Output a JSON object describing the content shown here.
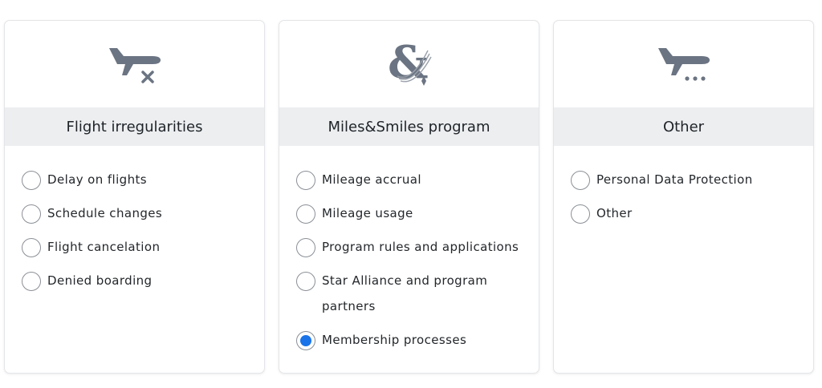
{
  "colors": {
    "icon": "#6b7482",
    "header_bg": "#eceef0",
    "radio_selected": "#1a73e8"
  },
  "cards": [
    {
      "icon": "plane-cancel-icon",
      "title": "Flight irregularities",
      "options": [
        {
          "label": "Delay on flights",
          "selected": false
        },
        {
          "label": "Schedule changes",
          "selected": false
        },
        {
          "label": "Flight cancelation",
          "selected": false
        },
        {
          "label": "Denied boarding",
          "selected": false
        }
      ]
    },
    {
      "icon": "ampersand-star-icon",
      "title": "Miles&Smiles program",
      "options": [
        {
          "label": "Mileage accrual",
          "selected": false
        },
        {
          "label": "Mileage usage",
          "selected": false
        },
        {
          "label": "Program rules and applications",
          "selected": false
        },
        {
          "label": "Star Alliance and program partners",
          "selected": false
        },
        {
          "label": "Membership processes",
          "selected": true
        }
      ]
    },
    {
      "icon": "plane-more-icon",
      "title": "Other",
      "options": [
        {
          "label": "Personal Data Protection",
          "selected": false
        },
        {
          "label": "Other",
          "selected": false
        }
      ]
    }
  ]
}
